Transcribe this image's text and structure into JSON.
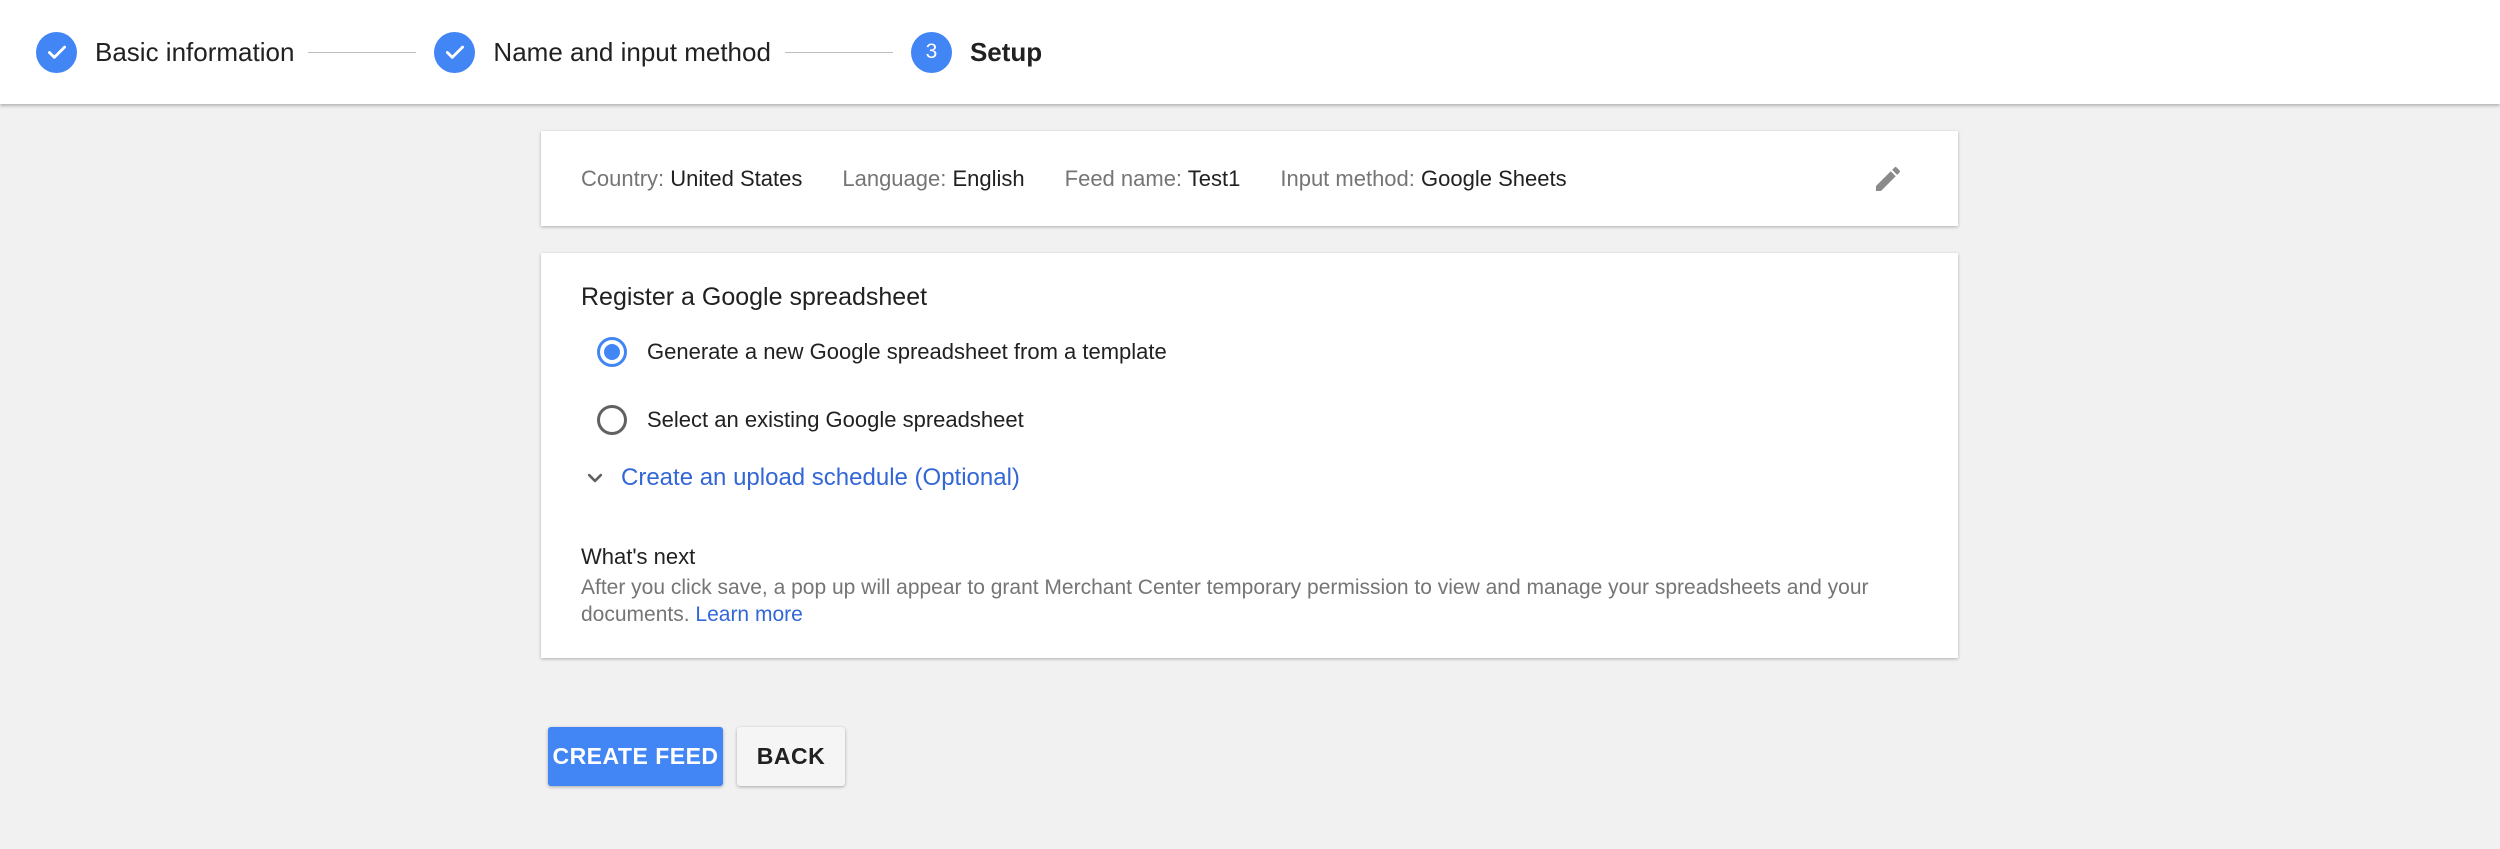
{
  "stepper": {
    "steps": [
      {
        "label": "Basic information",
        "state": "complete",
        "icon": "checkmark-icon"
      },
      {
        "label": "Name and input method",
        "state": "complete",
        "icon": "checkmark-icon"
      },
      {
        "label": "Setup",
        "state": "current",
        "number": "3"
      }
    ]
  },
  "summary": {
    "country_key": "Country:",
    "country_val": "United States",
    "language_key": "Language:",
    "language_val": "English",
    "feed_key": "Feed name:",
    "feed_val": "Test1",
    "input_key": "Input method:",
    "input_val": "Google Sheets",
    "edit_icon": "pencil-icon"
  },
  "register": {
    "title": "Register a Google spreadsheet",
    "options": [
      {
        "label": "Generate a new Google spreadsheet from a template",
        "checked": true
      },
      {
        "label": "Select an existing Google spreadsheet",
        "checked": false
      }
    ],
    "expander_icon": "chevron-down-icon",
    "schedule_label": "Create an upload schedule (Optional)",
    "whats_next_title": "What's next",
    "whats_next_body": "After you click save, a pop up will appear to grant Merchant Center temporary permission to view and manage your spreadsheets and your documents.",
    "learn_more": "Learn more"
  },
  "actions": {
    "create_label": "CREATE FEED",
    "back_label": "BACK"
  },
  "colors": {
    "accent": "#4285f4",
    "link": "#3367d6",
    "background": "#f1f1f1"
  }
}
